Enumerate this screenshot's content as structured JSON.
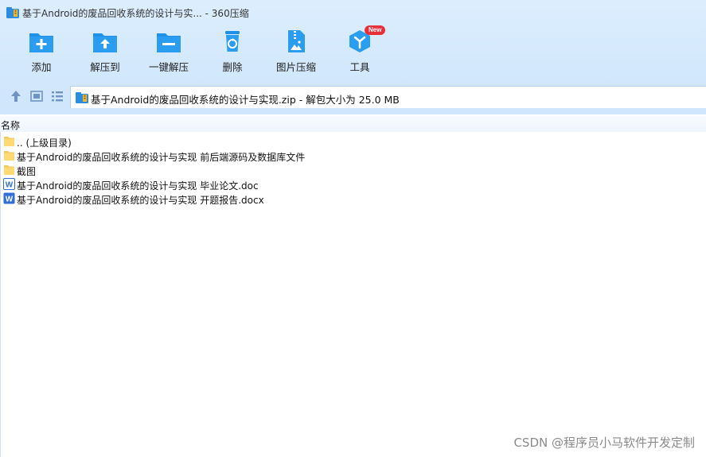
{
  "window": {
    "title": "基于Android的废品回收系统的设计与实... - 360压缩"
  },
  "toolbar": {
    "items": [
      {
        "id": "add",
        "label": "添加",
        "icon": "folder-plus-icon"
      },
      {
        "id": "extract-to",
        "label": "解压到",
        "icon": "folder-upload-icon"
      },
      {
        "id": "one-click-extract",
        "label": "一键解压",
        "icon": "folder-minus-icon"
      },
      {
        "id": "delete",
        "label": "删除",
        "icon": "recycle-bin-icon"
      },
      {
        "id": "image-compress",
        "label": "图片压缩",
        "icon": "image-zip-icon"
      },
      {
        "id": "tools",
        "label": "工具",
        "icon": "cube-tools-icon",
        "badge": "New"
      }
    ]
  },
  "path": {
    "text": "基于Android的废品回收系统的设计与实现.zip - 解包大小为 25.0 MB"
  },
  "file_list": {
    "column_name": "名称",
    "rows": [
      {
        "name": ".. (上级目录)",
        "type": "folder"
      },
      {
        "name": "基于Android的废品回收系统的设计与实现 前后端源码及数据库文件",
        "type": "folder"
      },
      {
        "name": "截图",
        "type": "folder"
      },
      {
        "name": "基于Android的废品回收系统的设计与实现 毕业论文.doc",
        "type": "doc"
      },
      {
        "name": "基于Android的废品回收系统的设计与实现 开题报告.docx",
        "type": "docx"
      }
    ]
  },
  "watermark": "CSDN @程序员小马软件开发定制",
  "colors": {
    "accent": "#1e90e8",
    "chrome": "#d3e8fc",
    "badge": "#e8303a"
  }
}
